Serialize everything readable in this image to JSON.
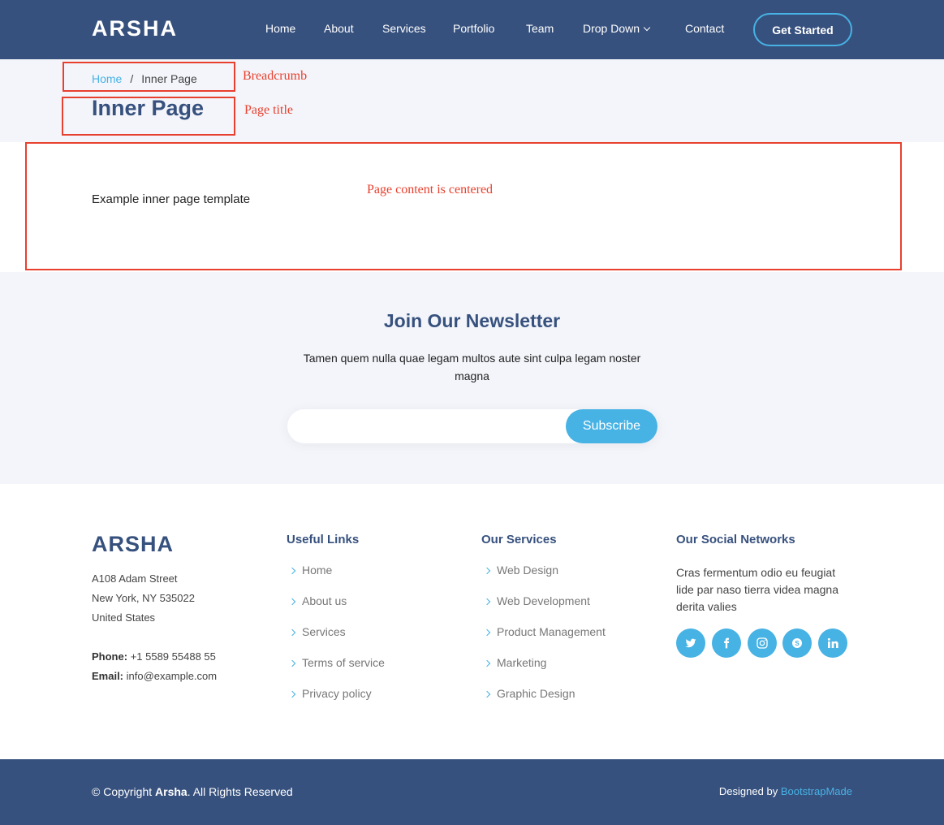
{
  "header": {
    "logo": "ARSHA",
    "nav": [
      "Home",
      "About",
      "Services",
      "Portfolio",
      "Team",
      "Drop Down",
      "Contact"
    ],
    "cta": "Get Started"
  },
  "breadcrumb": {
    "home": "Home",
    "separator": "/",
    "current": "Inner Page"
  },
  "page_title": "Inner Page",
  "annotations": {
    "breadcrumb": "Breadcrumb",
    "page_title": "Page title",
    "content": "Page content is centered"
  },
  "content": {
    "text": "Example inner page template"
  },
  "newsletter": {
    "title": "Join Our Newsletter",
    "description": "Tamen quem nulla quae legam multos aute sint culpa legam noster magna",
    "input_value": "",
    "button": "Subscribe"
  },
  "footer": {
    "logo": "ARSHA",
    "address": [
      "A108 Adam Street",
      "New York, NY 535022",
      "United States"
    ],
    "phone_label": "Phone:",
    "phone": "+1 5589 55488 55",
    "email_label": "Email:",
    "email": "info@example.com",
    "useful_links": {
      "title": "Useful Links",
      "items": [
        "Home",
        "About us",
        "Services",
        "Terms of service",
        "Privacy policy"
      ]
    },
    "services": {
      "title": "Our Services",
      "items": [
        "Web Design",
        "Web Development",
        "Product Management",
        "Marketing",
        "Graphic Design"
      ]
    },
    "social": {
      "title": "Our Social Networks",
      "text": "Cras fermentum odio eu feugiat lide par naso tierra videa magna derita valies",
      "icons": [
        "twitter-icon",
        "facebook-icon",
        "instagram-icon",
        "skype-icon",
        "linkedin-icon"
      ]
    },
    "copyright_prefix": "© Copyright",
    "copyright_brand": "Arsha",
    "copyright_suffix": ". All Rights Reserved",
    "designed_by": "Designed by",
    "designer": "BootstrapMade"
  },
  "colors": {
    "primary": "#37517e",
    "accent": "#47b2e4",
    "section_bg": "#f3f5fa",
    "annotation": "#e8402e"
  }
}
